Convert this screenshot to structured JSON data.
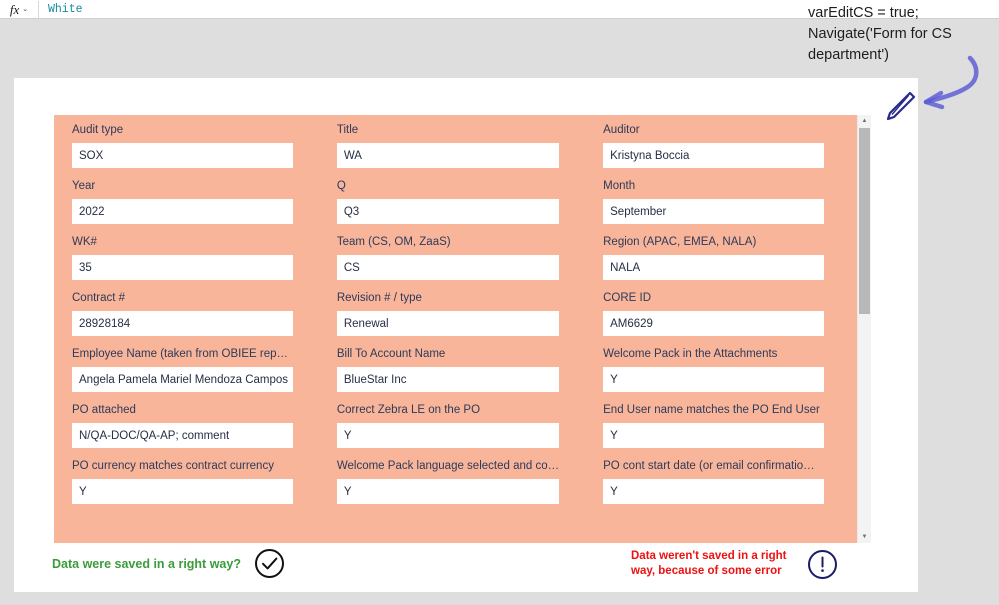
{
  "formula_bar": {
    "fx_label": "fx",
    "chevron": "⌄",
    "value": "White"
  },
  "annotation": {
    "text": "varEditCS = true;\nNavigate('Form for CS\ndepartment')",
    "arrow_color": "#5b5bd6",
    "pen_color": "#2a2a8c"
  },
  "form": {
    "background_color": "#f8b59a",
    "label_color": "#2e3a59",
    "fields": [
      {
        "label": "Audit type",
        "value": "SOX"
      },
      {
        "label": "Title",
        "value": "WA"
      },
      {
        "label": "Auditor",
        "value": "Kristyna Boccia"
      },
      {
        "label": "Year",
        "value": "2022"
      },
      {
        "label": "Q",
        "value": "Q3"
      },
      {
        "label": "Month",
        "value": "September"
      },
      {
        "label": "WK#",
        "value": "35"
      },
      {
        "label": "Team (CS, OM, ZaaS)",
        "value": "CS"
      },
      {
        "label": "Region (APAC, EMEA, NALA)",
        "value": "NALA"
      },
      {
        "label": "Contract #",
        "value": "28928184"
      },
      {
        "label": "Revision # / type",
        "value": "Renewal"
      },
      {
        "label": "CORE ID",
        "value": "AM6629"
      },
      {
        "label": "Employee Name (taken from OBIEE rep…",
        "value": "Angela Pamela Mariel Mendoza Campos"
      },
      {
        "label": "Bill To Account Name",
        "value": "BlueStar Inc"
      },
      {
        "label": "Welcome Pack in the Attachments",
        "value": "Y"
      },
      {
        "label": "PO attached",
        "value": "N/QA-DOC/QA-AP; comment"
      },
      {
        "label": "Correct Zebra LE on the PO",
        "value": "Y"
      },
      {
        "label": "End User name matches the PO End User",
        "value": "Y"
      },
      {
        "label": "PO currency matches contract currency",
        "value": "Y"
      },
      {
        "label": "Welcome Pack language selected and co…",
        "value": "Y"
      },
      {
        "label": "PO cont start date (or email confirmatio…",
        "value": "Y"
      }
    ]
  },
  "scrollbar": {
    "up_arrow": "▲",
    "down_arrow": "▼"
  },
  "status": {
    "success_text": "Data were saved in a right way?",
    "success_color": "#3a9c3a",
    "success_icon": "check-circle-icon",
    "error_text": "Data weren't saved in a right way, because of some error",
    "error_color": "#ee1111",
    "error_icon": "exclamation-circle-icon"
  }
}
